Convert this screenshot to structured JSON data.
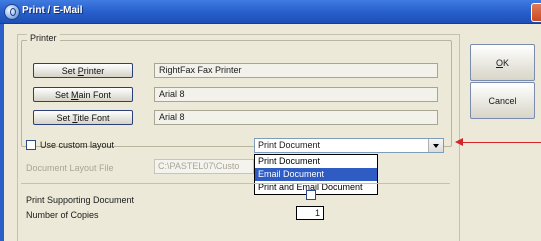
{
  "window": {
    "title": "Print / E-Mail"
  },
  "printer_group": {
    "label": "Printer",
    "set_printer": {
      "prefix": "Set ",
      "accel": "P",
      "rest": "rinter",
      "value": "RightFax Fax Printer"
    },
    "set_main_font": {
      "prefix": "Set ",
      "accel": "M",
      "rest": "ain Font",
      "value": "Arial 8"
    },
    "set_title_font": {
      "prefix": "Set ",
      "accel": "T",
      "rest": "itle Font",
      "value": "Arial 8"
    }
  },
  "custom_layout": {
    "label": "Use custom layout",
    "checked": false
  },
  "output_select": {
    "selected": "Print Document",
    "options": [
      "Print Document",
      "Email Document",
      "Print and Email Document"
    ],
    "highlighted_index": 1
  },
  "document_layout": {
    "label": "Document Layout File",
    "value": "C:\\PASTEL07\\Custo"
  },
  "print_supporting": {
    "label": "Print Supporting Document",
    "checked": false
  },
  "copies": {
    "label": "Number of Copies",
    "value": "1"
  },
  "buttons": {
    "ok_accel": "O",
    "ok_rest": "K",
    "cancel": "Cancel"
  },
  "colors": {
    "title_bar": "#2a62cf",
    "highlight": "#2e5cc2",
    "annotation_arrow": "#d3242a"
  }
}
